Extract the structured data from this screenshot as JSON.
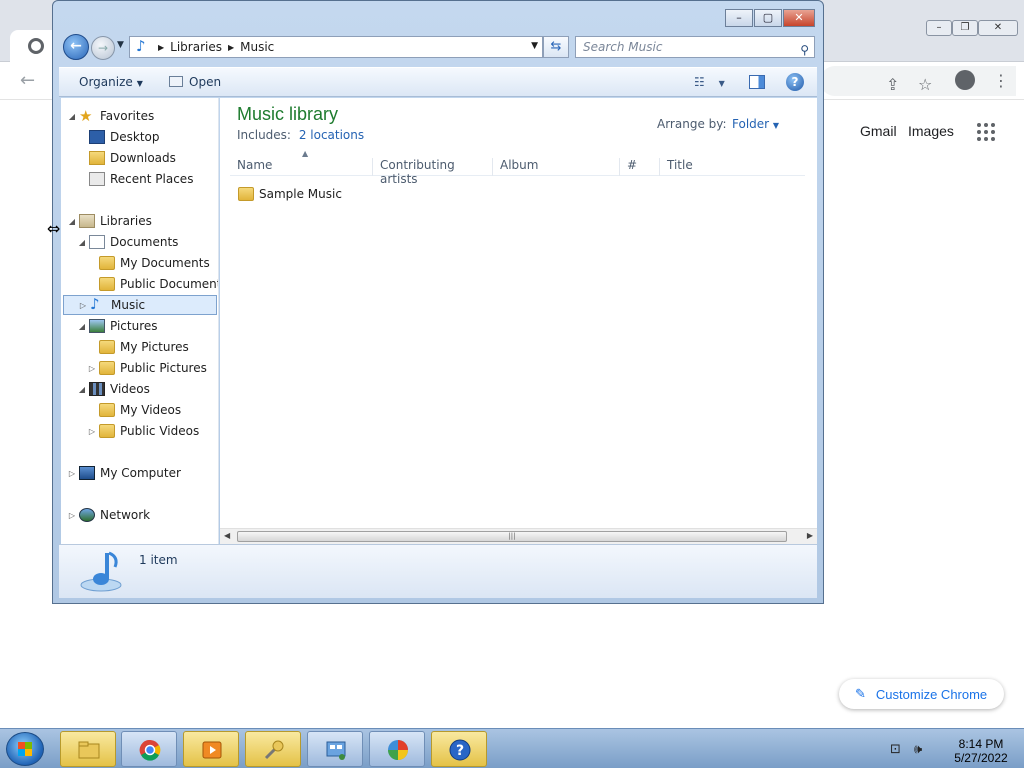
{
  "chrome": {
    "gmail": "Gmail",
    "images": "Images",
    "customize": "Customize Chrome"
  },
  "explorer": {
    "breadcrumb": [
      "Libraries",
      "Music"
    ],
    "search_placeholder": "Search Music",
    "toolbar": {
      "organize": "Organize",
      "open": "Open"
    },
    "nav": {
      "favorites": "Favorites",
      "desktop": "Desktop",
      "downloads": "Downloads",
      "recent": "Recent Places",
      "libraries": "Libraries",
      "documents": "Documents",
      "my_documents": "My Documents",
      "public_documents": "Public Documents",
      "music": "Music",
      "pictures": "Pictures",
      "my_pictures": "My Pictures",
      "public_pictures": "Public Pictures",
      "videos": "Videos",
      "my_videos": "My Videos",
      "public_videos": "Public Videos",
      "computer": "My Computer",
      "network": "Network"
    },
    "library": {
      "title": "Music library",
      "includes_label": "Includes:",
      "includes_link": "2 locations",
      "arrange_label": "Arrange by:",
      "arrange_value": "Folder"
    },
    "columns": [
      "Name",
      "Contributing artists",
      "Album",
      "#",
      "Title"
    ],
    "items": [
      {
        "name": "Sample Music"
      }
    ],
    "status": "1 item"
  },
  "taskbar": {
    "time": "8:14 PM",
    "date": "5/27/2022"
  },
  "colors": {
    "library_title": "#1e7b2e",
    "link": "#2563b3",
    "selection": "#dcebfc"
  }
}
